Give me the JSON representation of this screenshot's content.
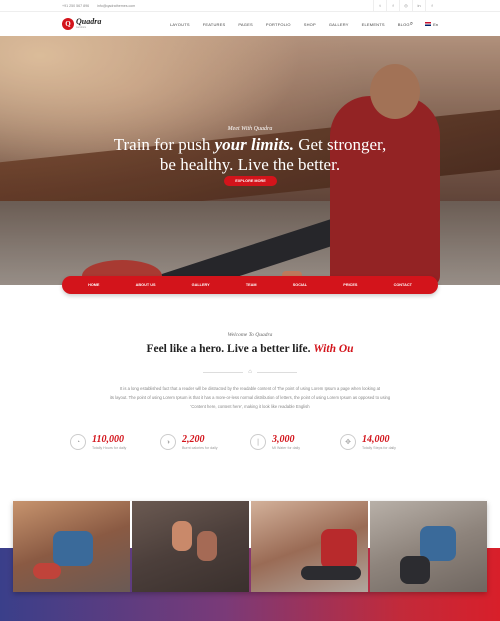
{
  "topbar": {
    "phone": "+91 250 567 896",
    "email": "info@qadrathemes.com",
    "social_icons": [
      "twitter-icon",
      "facebook-icon",
      "instagram-icon",
      "linkedin-icon",
      "facebook-f-icon"
    ]
  },
  "header": {
    "logo_text": "Quadra",
    "logo_sub": "Aerobics",
    "nav": [
      "LAYOUTS",
      "FEATURES",
      "PAGES",
      "PORTFOLIO",
      "SHOP",
      "GALLERY",
      "ELEMENTS",
      "BLOG"
    ],
    "language": "En"
  },
  "hero": {
    "tagline": "Meet With Quadra",
    "headline_part1": "Train for push ",
    "headline_em": "your limits.",
    "headline_part2": " Get stronger,",
    "headline_line2": "be healthy. Live the better.",
    "cta": "EXPLORE MORE"
  },
  "menubar": [
    "HOME",
    "ABOUT US",
    "GALLERY",
    "TEAM",
    "SOCIAL",
    "PRICES",
    "CONTACT"
  ],
  "intro": {
    "welcome": "Welcome To Quadra",
    "title": "Feel like a hero. Live a better life.",
    "title_em": "With Ou",
    "text_line1": "It is a long established fact that a reader will be distracted by the readable content of The point of using Lorem Ipsum a page when looking at",
    "text_line2": "its layout. The point of using Lorem Ipsum is that it has a more-or-less normal distribution of letters, the point of using Lorem Ipsum as opposed to using",
    "text_line3": "'Content here, content here', making it look like readable English"
  },
  "stats": [
    {
      "icon": "stopwatch-icon",
      "value": "110,000",
      "label": "Totally Hours for daily"
    },
    {
      "icon": "gauge-icon",
      "value": "2,200",
      "label": "Burnt calories for daily"
    },
    {
      "icon": "thermometer-icon",
      "value": "3,000",
      "label": "MI Water for daily"
    },
    {
      "icon": "footsteps-icon",
      "value": "14,000",
      "label": "Totally Steps for daily"
    }
  ],
  "colors": {
    "accent": "#d3141b",
    "band_start": "#3a3f8a",
    "band_end": "#d81f2a"
  }
}
